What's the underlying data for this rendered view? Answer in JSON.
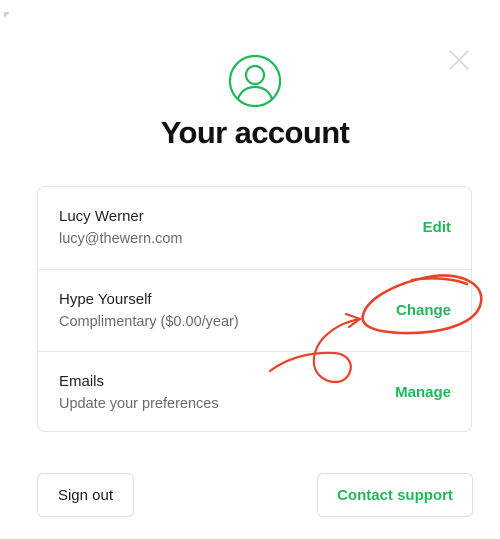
{
  "dialog": {
    "title": "Your account",
    "avatar_icon": "user-circle-icon",
    "close_icon": "close-icon",
    "accent_color": "#21b85a",
    "annotation_color": "#e8442a"
  },
  "account_rows": [
    {
      "title": "Lucy Werner",
      "subtitle": "lucy@thewern.com",
      "action": "Edit"
    },
    {
      "title": "Hype Yourself",
      "subtitle": "Complimentary ($0.00/year)",
      "action": "Change"
    },
    {
      "title": "Emails",
      "subtitle": "Update your preferences",
      "action": "Manage"
    }
  ],
  "footer": {
    "sign_out_label": "Sign out",
    "contact_support_label": "Contact support"
  }
}
